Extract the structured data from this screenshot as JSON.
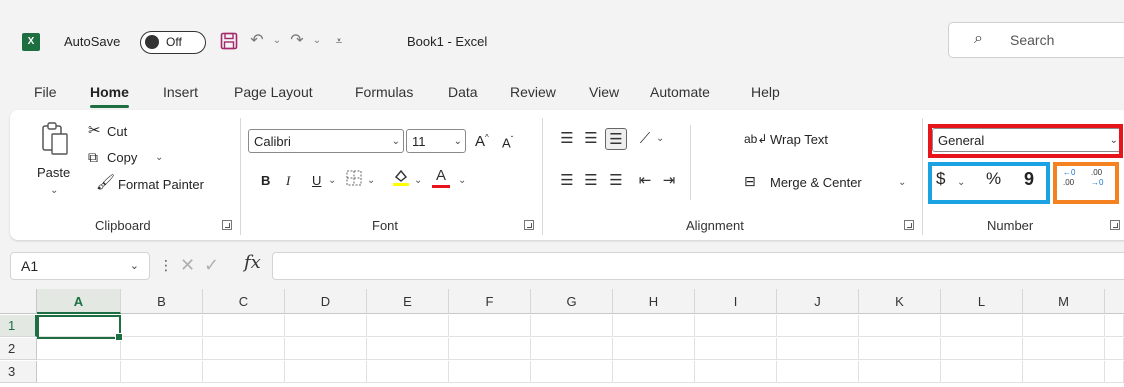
{
  "title_bar": {
    "app_icon_text": "X",
    "autosave_label": "AutoSave",
    "autosave_state": "Off",
    "doc_title": "Book1  -  Excel",
    "search_placeholder": "Search",
    "icons": [
      "save-icon",
      "undo-icon",
      "redo-icon",
      "customize-qat-icon",
      "search-icon"
    ]
  },
  "tabs": [
    {
      "label": "File"
    },
    {
      "label": "Home",
      "active": true
    },
    {
      "label": "Insert"
    },
    {
      "label": "Page Layout"
    },
    {
      "label": "Formulas"
    },
    {
      "label": "Data"
    },
    {
      "label": "Review"
    },
    {
      "label": "View"
    },
    {
      "label": "Automate"
    },
    {
      "label": "Help"
    }
  ],
  "ribbon": {
    "clipboard": {
      "paste": "Paste",
      "cut": "Cut",
      "copy": "Copy",
      "format_painter": "Format Painter",
      "label": "Clipboard"
    },
    "font": {
      "font_name": "Calibri",
      "font_size": "11",
      "bold": "B",
      "italic": "I",
      "underline": "U",
      "font_color_glyph": "A",
      "grow_glyph": "A",
      "shrink_glyph": "A",
      "label": "Font",
      "fill_color": "#ffff00",
      "font_color": "#e8141c"
    },
    "alignment": {
      "wrap_text": "Wrap Text",
      "merge_center": "Merge & Center",
      "label": "Alignment"
    },
    "number": {
      "format": "General",
      "currency_glyph": "$",
      "percent_glyph": "%",
      "comma_glyph": "9",
      "increase_decimal_top": "0",
      "increase_decimal_bottom": ".00",
      "decrease_decimal_top": ".00",
      "decrease_decimal_bottom": "0",
      "label": "Number"
    },
    "highlight_colors": {
      "red": "#e8141c",
      "blue": "#1aa2e3",
      "orange": "#f58220"
    }
  },
  "formula_bar": {
    "name_box": "A1",
    "fx_label": "fx",
    "formula": ""
  },
  "grid": {
    "columns": [
      "A",
      "B",
      "C",
      "D",
      "E",
      "F",
      "G",
      "H",
      "I",
      "J",
      "K",
      "L",
      "M"
    ],
    "rows": [
      "1",
      "2",
      "3"
    ],
    "active_cell": "A1"
  },
  "accent_color": "#1d6f42"
}
